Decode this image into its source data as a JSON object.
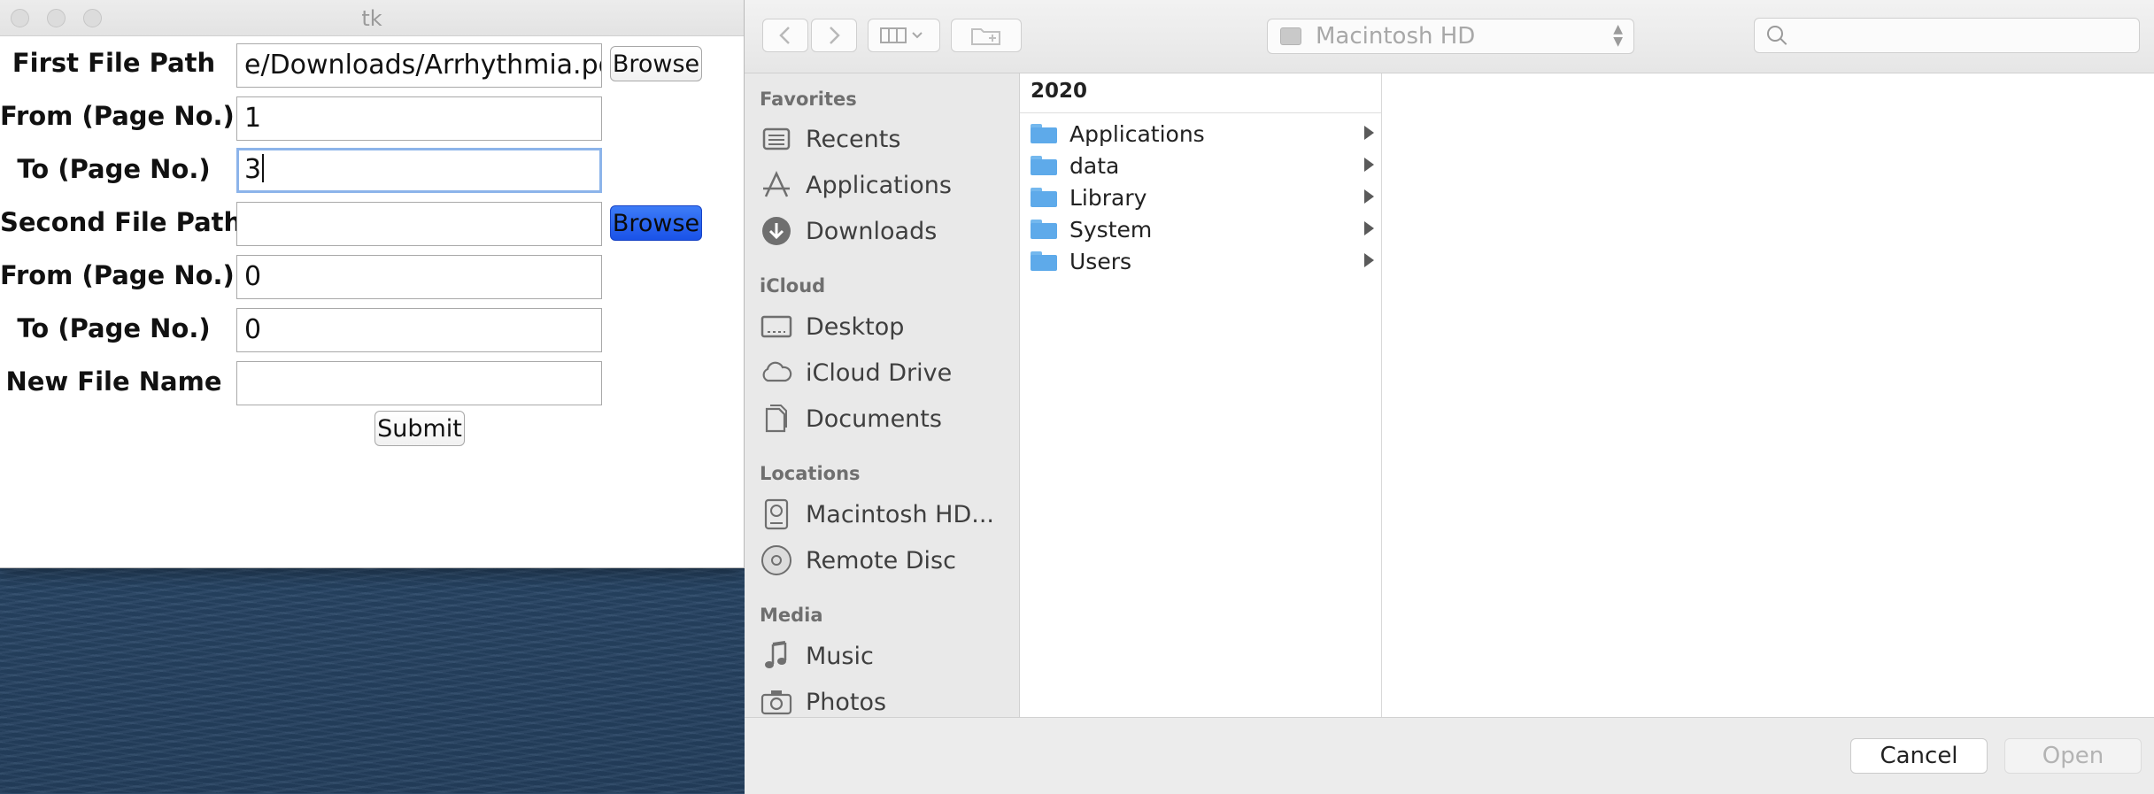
{
  "tk_window": {
    "title": "tk",
    "fields": [
      {
        "label": "First File Path",
        "value": "e/Downloads/Arrhythmia.pdf",
        "button": "Browse"
      },
      {
        "label": "From (Page No.)",
        "value": "1"
      },
      {
        "label": "To (Page No.)",
        "value": "3"
      },
      {
        "label": "Second File Path",
        "value": "",
        "button": "Browse"
      },
      {
        "label": "From (Page No.)",
        "value": "0"
      },
      {
        "label": "To (Page No.)",
        "value": "0"
      },
      {
        "label": "New File Name",
        "value": ""
      }
    ],
    "submit_label": "Submit",
    "accent_color": "#1a52e8"
  },
  "dialog": {
    "location": "Macintosh HD",
    "search_placeholder": "",
    "sidebar": {
      "sections": [
        {
          "title": "Favorites",
          "items": [
            {
              "label": "Recents",
              "icon": "recents-icon"
            },
            {
              "label": "Applications",
              "icon": "applications-icon"
            },
            {
              "label": "Downloads",
              "icon": "downloads-icon"
            }
          ]
        },
        {
          "title": "iCloud",
          "items": [
            {
              "label": "Desktop",
              "icon": "desktop-icon"
            },
            {
              "label": "iCloud Drive",
              "icon": "cloud-icon"
            },
            {
              "label": "Documents",
              "icon": "documents-icon"
            }
          ]
        },
        {
          "title": "Locations",
          "items": [
            {
              "label": "Macintosh HD...",
              "icon": "hard-disk-icon"
            },
            {
              "label": "Remote Disc",
              "icon": "disc-icon"
            }
          ]
        },
        {
          "title": "Media",
          "items": [
            {
              "label": "Music",
              "icon": "music-icon"
            },
            {
              "label": "Photos",
              "icon": "camera-icon"
            }
          ]
        }
      ]
    },
    "column": {
      "header": "2020",
      "rows": [
        "Applications",
        "data",
        "Library",
        "System",
        "Users"
      ]
    },
    "cancel_label": "Cancel",
    "open_label": "Open"
  }
}
